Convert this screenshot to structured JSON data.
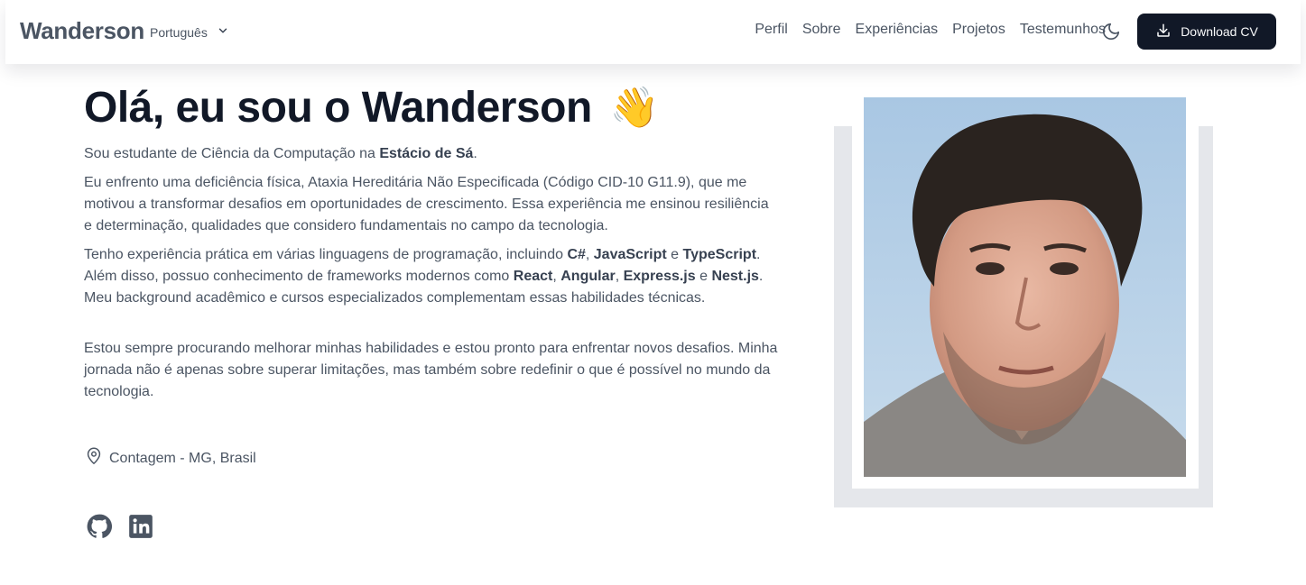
{
  "header": {
    "brand": "Wanderson",
    "language": "Português",
    "nav": [
      "Perfil",
      "Sobre",
      "Experiências",
      "Projetos",
      "Testemunhos"
    ],
    "download_label": "Download CV",
    "theme_icon": "moon-icon",
    "download_icon": "download-icon"
  },
  "hero": {
    "title": "Olá, eu sou o Wanderson",
    "emoji": "👋",
    "p1": [
      {
        "t": "Sou estudante de Ciência da Computação na ",
        "b": false
      },
      {
        "t": "Estácio de Sá",
        "b": true
      },
      {
        "t": ".",
        "b": false
      }
    ],
    "p2": [
      {
        "t": "Eu enfrento uma deficiência física, Ataxia Hereditária Não Especificada (Código CID-10 G11.9), que me motivou a transformar desafios em oportunidades de crescimento. Essa experiência me ensinou resiliência e determinação, qualidades que considero fundamentais no campo da tecnologia.",
        "b": false
      }
    ],
    "p3": [
      {
        "t": "Tenho experiência prática em várias linguagens de programação, incluindo ",
        "b": false
      },
      {
        "t": "C#",
        "b": true
      },
      {
        "t": ", ",
        "b": false
      },
      {
        "t": "JavaScript",
        "b": true
      },
      {
        "t": " e ",
        "b": false
      },
      {
        "t": "TypeScript",
        "b": true
      },
      {
        "t": ". Além disso, possuo conhecimento de frameworks modernos como ",
        "b": false
      },
      {
        "t": "React",
        "b": true
      },
      {
        "t": ", ",
        "b": false
      },
      {
        "t": "Angular",
        "b": true
      },
      {
        "t": ", ",
        "b": false
      },
      {
        "t": "Express.js",
        "b": true
      },
      {
        "t": " e ",
        "b": false
      },
      {
        "t": "Nest.js",
        "b": true
      },
      {
        "t": ". Meu background acadêmico e cursos especializados complementam essas habilidades técnicas.",
        "b": false
      }
    ],
    "p4": [
      {
        "t": "Estou sempre procurando melhorar minhas habilidades e estou pronto para enfrentar novos desafios. Minha jornada não é apenas sobre superar limitações, mas também sobre redefinir o que é possível no mundo da tecnologia.",
        "b": false
      }
    ],
    "location": "Contagem - MG, Brasil",
    "location_icon": "map-pin-icon",
    "social": [
      "github-icon",
      "linkedin-icon"
    ]
  },
  "colors": {
    "dark": "#111827",
    "text": "#4b5563",
    "frame": "#e5e7eb"
  }
}
